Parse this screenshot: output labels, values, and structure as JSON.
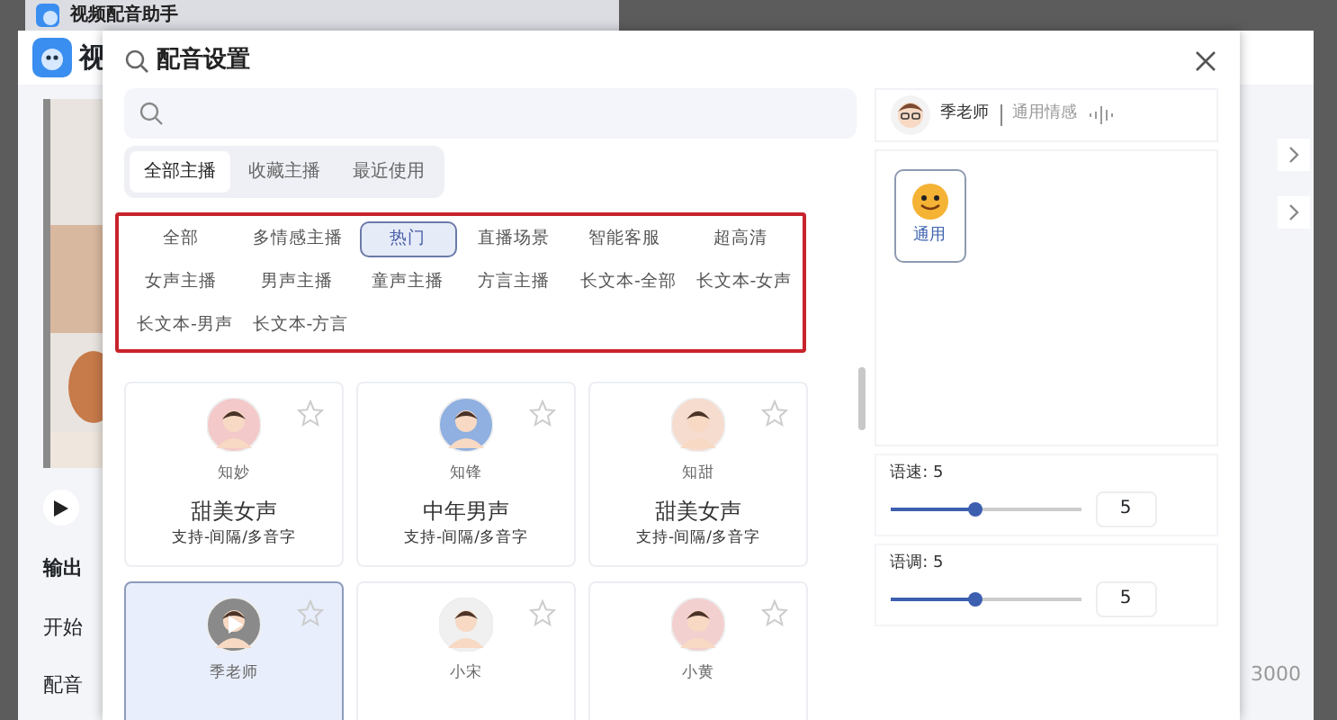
{
  "back_window": {
    "title": "视频配音助手"
  },
  "app": {
    "title": "视",
    "labels": [
      {
        "text": "输出",
        "bold": true
      },
      {
        "text": "开始",
        "bold": false
      },
      {
        "text": "配音",
        "bold": false
      }
    ],
    "right_number": "3000"
  },
  "dialog": {
    "title": "配音设置",
    "tabs": [
      {
        "label": "全部主播",
        "selected": true
      },
      {
        "label": "收藏主播",
        "selected": false
      },
      {
        "label": "最近使用",
        "selected": false
      }
    ],
    "tags": [
      {
        "label": "全部",
        "selected": false
      },
      {
        "label": "多情感主播",
        "selected": false
      },
      {
        "label": "热门",
        "selected": true
      },
      {
        "label": "直播场景",
        "selected": false
      },
      {
        "label": "智能客服",
        "selected": false
      },
      {
        "label": "超高清",
        "selected": false
      },
      {
        "label": "女声主播",
        "selected": false
      },
      {
        "label": "男声主播",
        "selected": false
      },
      {
        "label": "童声主播",
        "selected": false
      },
      {
        "label": "方言主播",
        "selected": false
      },
      {
        "label": "长文本-全部",
        "selected": false
      },
      {
        "label": "长文本-女声",
        "selected": false
      },
      {
        "label": "长文本-男声",
        "selected": false
      },
      {
        "label": "长文本-方言",
        "selected": false
      }
    ],
    "voices": [
      {
        "name": "知妙",
        "title": "甜美女声",
        "features": "支持-间隔/多音字",
        "selected": false,
        "starred": false,
        "color": "#f3c9c9"
      },
      {
        "name": "知锋",
        "title": "中年男声",
        "features": "支持-间隔/多音字",
        "selected": false,
        "starred": false,
        "color": "#8fb0e0"
      },
      {
        "name": "知甜",
        "title": "甜美女声",
        "features": "支持-间隔/多音字",
        "selected": false,
        "starred": false,
        "color": "#f6dccf"
      },
      {
        "name": "季老师",
        "selected": true,
        "starred": false,
        "color": "#8a8a8a"
      },
      {
        "name": "小宋",
        "selected": false,
        "starred": false,
        "color": "#f0f0f0"
      },
      {
        "name": "小黄",
        "selected": false,
        "starred": false,
        "color": "#f3d0d0"
      }
    ],
    "current": {
      "name": "季老师",
      "emotion": "通用情感"
    },
    "emotions": [
      {
        "label": "通用",
        "selected": true
      }
    ],
    "sliders": [
      {
        "label": "语速: 5",
        "level": 0.45,
        "value": "5"
      },
      {
        "label": "语调: 5",
        "level": 0.45,
        "value": "5"
      }
    ]
  }
}
